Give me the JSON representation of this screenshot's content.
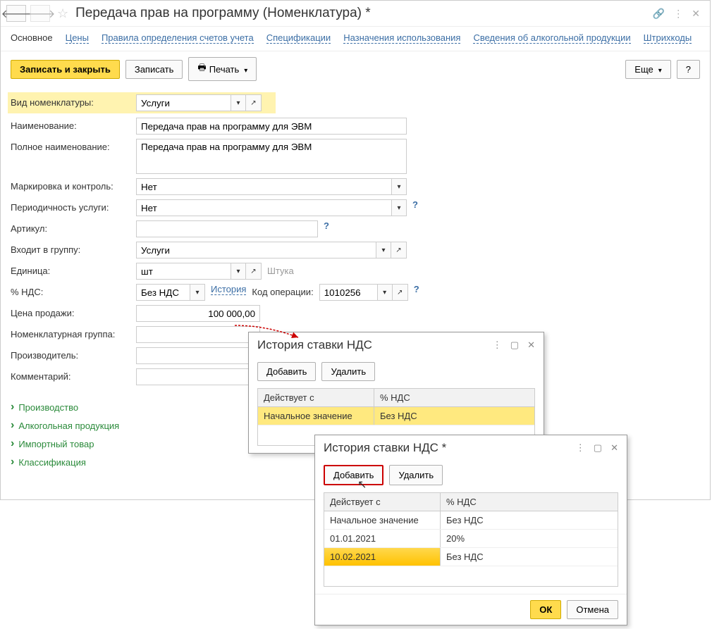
{
  "title": "Передача прав на программу (Номенклатура) *",
  "tabs": [
    "Основное",
    "Цены",
    "Правила определения счетов учета",
    "Спецификации",
    "Назначения использования",
    "Сведения об алкогольной продукции",
    "Штрихкоды"
  ],
  "toolbar": {
    "save_close": "Записать и закрыть",
    "save": "Записать",
    "print": "Печать",
    "more": "Еще",
    "help": "?"
  },
  "fields": {
    "nomen_type": {
      "label": "Вид номенклатуры:",
      "value": "Услуги"
    },
    "name": {
      "label": "Наименование:",
      "value": "Передача прав на программу для ЭВМ"
    },
    "full_name": {
      "label": "Полное наименование:",
      "value": "Передача прав на программу для ЭВМ"
    },
    "marking": {
      "label": "Маркировка и контроль:",
      "value": "Нет"
    },
    "periodicity": {
      "label": "Периодичность услуги:",
      "value": "Нет"
    },
    "article": {
      "label": "Артикул:",
      "value": ""
    },
    "group": {
      "label": "Входит в группу:",
      "value": "Услуги"
    },
    "unit": {
      "label": "Единица:",
      "value": "шт",
      "hint": "Штука"
    },
    "vat": {
      "label": "% НДС:",
      "value": "Без НДС",
      "history_link": "История"
    },
    "op_code": {
      "label": "Код операции:",
      "value": "1010256"
    },
    "sale_price": {
      "label": "Цена продажи:",
      "value": "100 000,00"
    },
    "nomen_group": {
      "label": "Номенклатурная группа:",
      "value": ""
    },
    "manufacturer": {
      "label": "Производитель:",
      "value": ""
    },
    "comment": {
      "label": "Комментарий:",
      "value": ""
    }
  },
  "collapse": [
    "Производство",
    "Алкогольная продукция",
    "Импортный товар",
    "Классификация"
  ],
  "popup1": {
    "title": "История ставки НДС",
    "add": "Добавить",
    "delete": "Удалить",
    "col1": "Действует с",
    "col2": "% НДС",
    "row_initial": "Начальное значение",
    "row_initial_val": "Без НДС"
  },
  "popup2": {
    "title": "История ставки НДС *",
    "add": "Добавить",
    "delete": "Удалить",
    "col1": "Действует с",
    "col2": "% НДС",
    "rows": [
      {
        "c1": "Начальное значение",
        "c2": "Без НДС"
      },
      {
        "c1": "01.01.2021",
        "c2": "20%"
      },
      {
        "c1": "10.02.2021",
        "c2": "Без НДС"
      }
    ],
    "ok": "ОК",
    "cancel": "Отмена"
  }
}
